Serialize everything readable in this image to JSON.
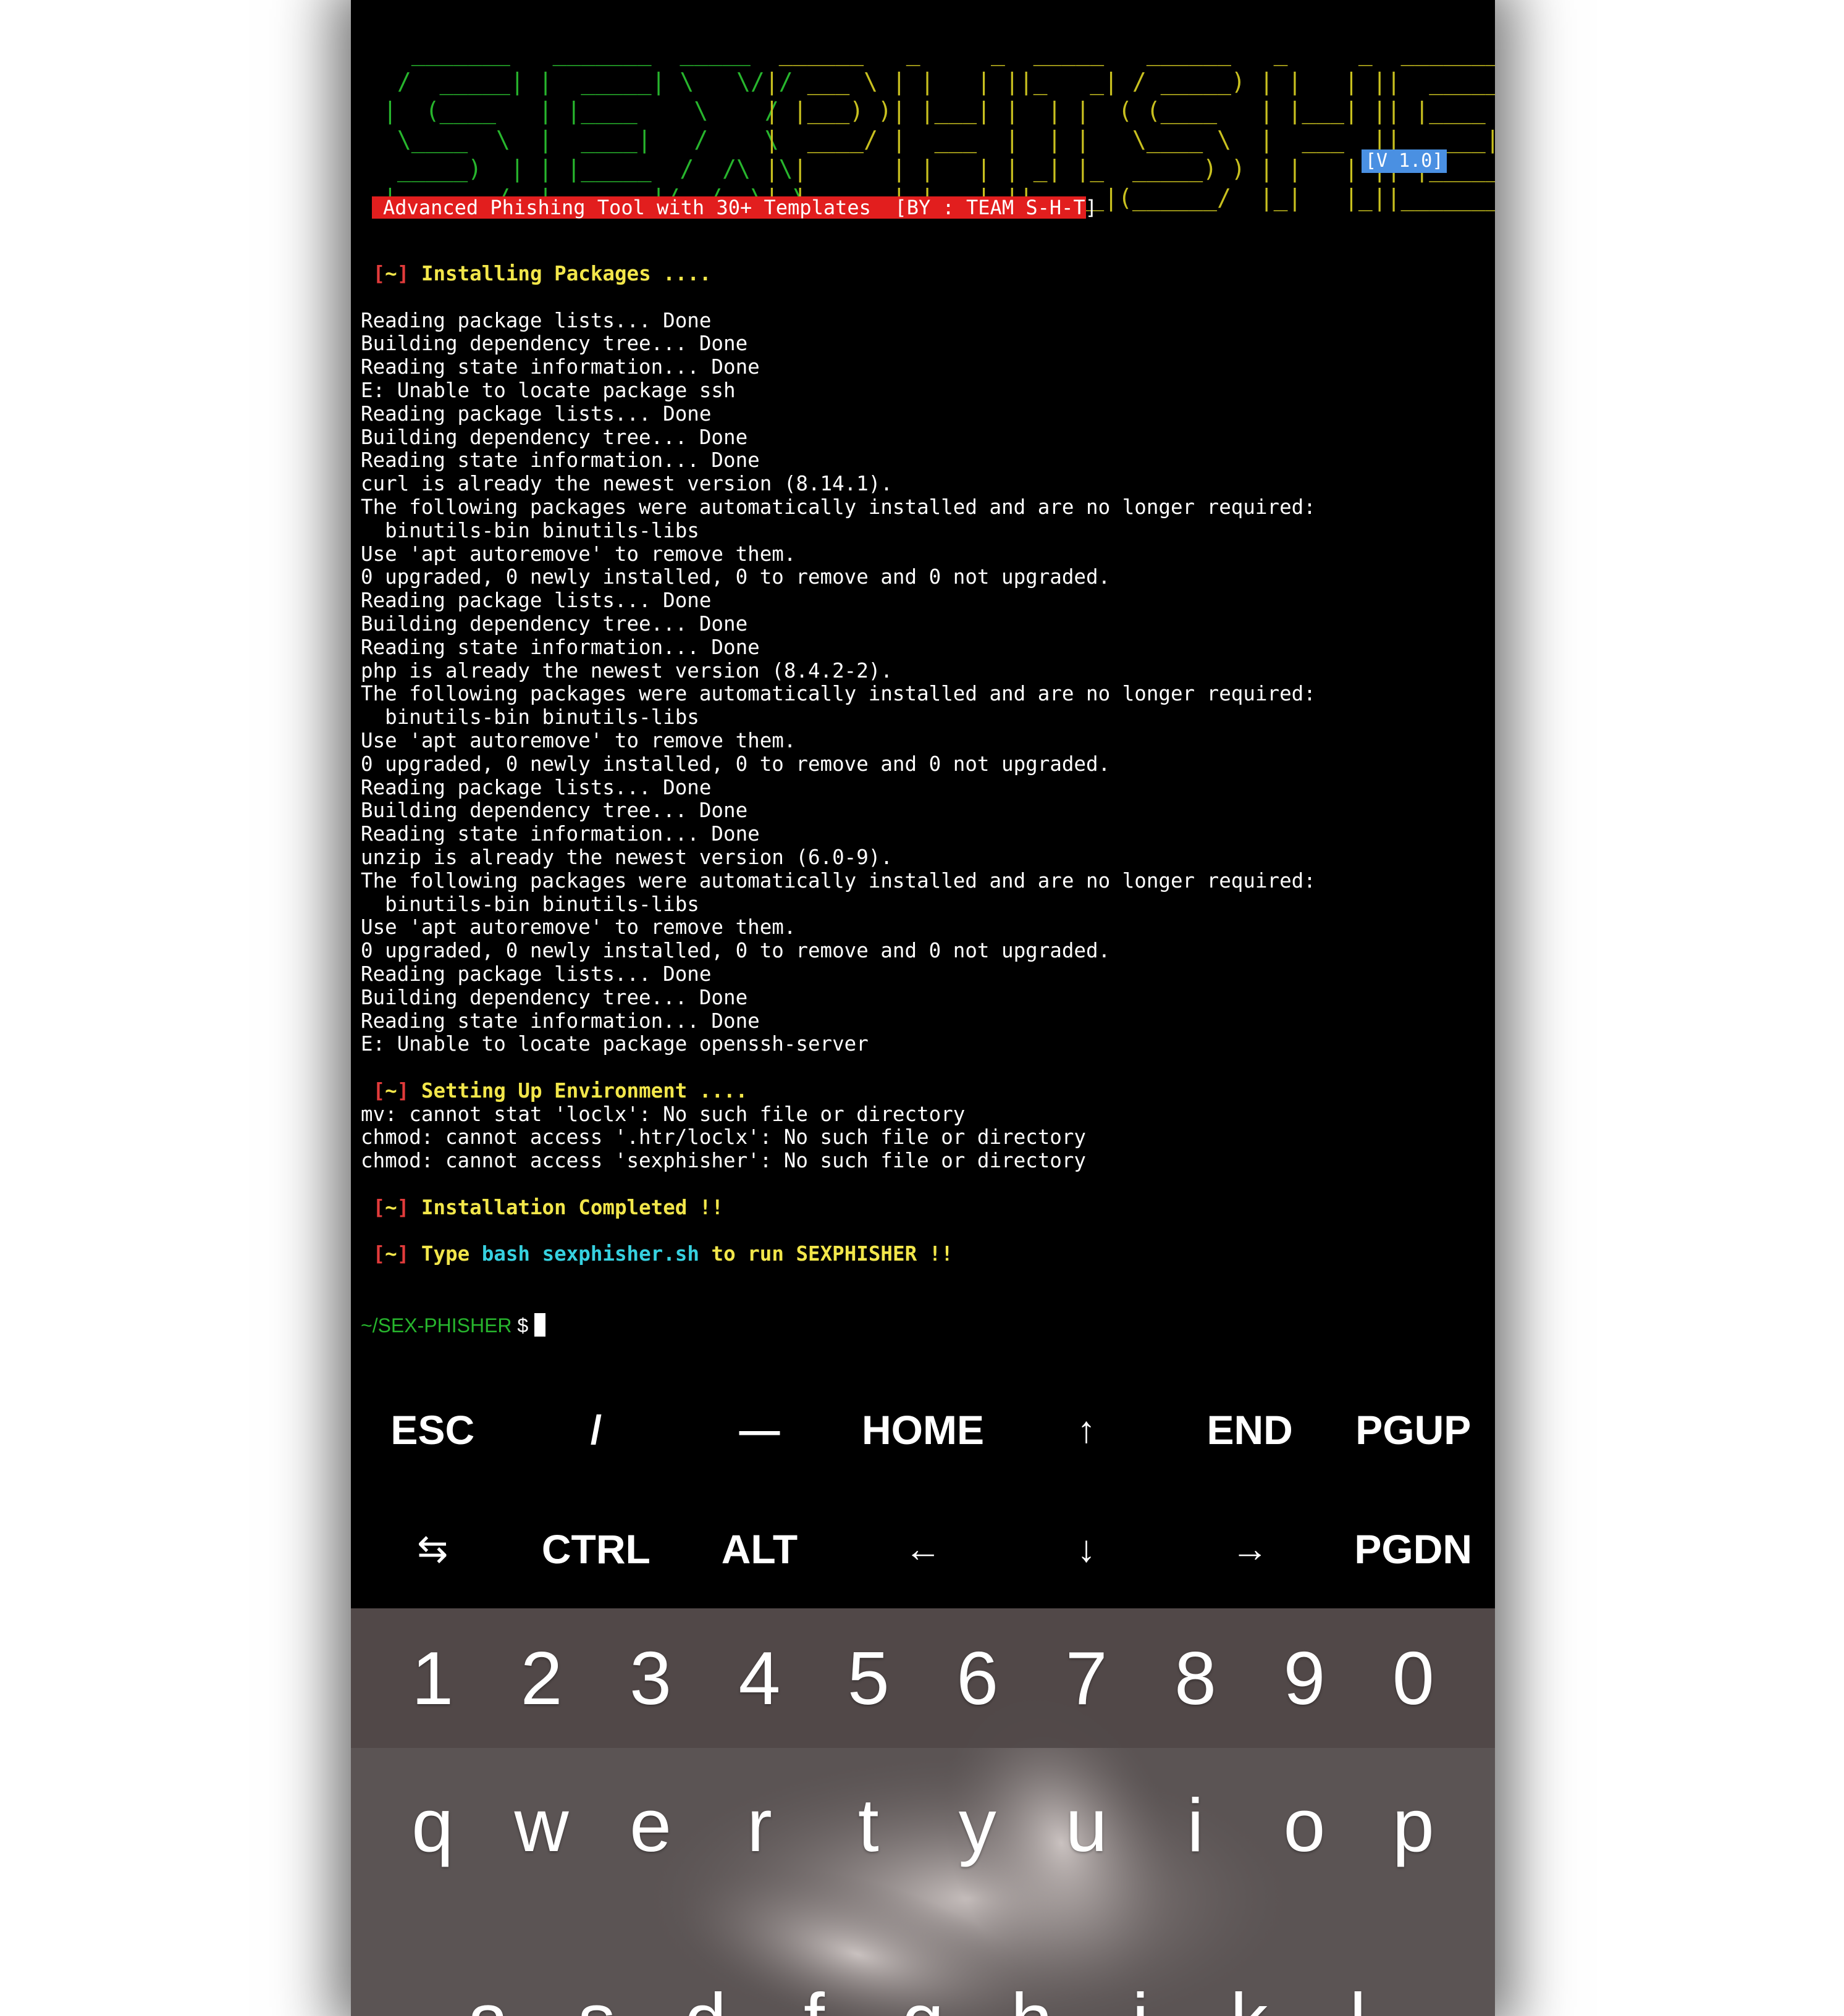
{
  "banner": {
    "sex_art": "  _______   _______  _____  _\n /  _____| |  _____| \\   \\/ /\n|  (____   | |____    \\    /\n \\____  \\  |  ____|   /    \\\n _____)  | | |_____  /  /\\  \\\n|_______/  |_______|/__/  \\__\\",
    "phisher_art": " ______   _     _  _____   ______   _     _  _______  ______\n|  ___ \\ | |   | ||_   _| / _____) | |   | ||  _____||  ___ \\\n| |___) )| |___| |  | |  ( (____   | |___| || |____  | |___) )\n|  ____/ |  ___  |  | |   \\____ \\  |  ___  ||  ____| |  __  /\n| |      | |   | | _| |_  _____) ) | |   | || |_____ | |  \\ \\\n|_|      |_|   |_||_____|(______/  |_|   |_||_______||_|   \\_\\",
    "version": "[V 1.0]",
    "tagline": "Advanced Phishing Tool with 30+ Templates  [BY : TEAM S-H-T]"
  },
  "status": {
    "installing": "Installing Packages ....",
    "environment": "Setting Up Environment ....",
    "completed": "Installation Completed !!",
    "marker_open": "[",
    "marker_tilde": "~",
    "marker_close": "]",
    "type_prefix": "Type ",
    "type_command": "bash sexphisher.sh",
    "type_suffix": " to run SEXPHISHER !!"
  },
  "log_install": [
    "Reading package lists... Done",
    "Building dependency tree... Done",
    "Reading state information... Done",
    "E: Unable to locate package ssh",
    "Reading package lists... Done",
    "Building dependency tree... Done",
    "Reading state information... Done",
    "curl is already the newest version (8.14.1).",
    "The following packages were automatically installed and are no longer required:",
    "  binutils-bin binutils-libs",
    "Use 'apt autoremove' to remove them.",
    "0 upgraded, 0 newly installed, 0 to remove and 0 not upgraded.",
    "Reading package lists... Done",
    "Building dependency tree... Done",
    "Reading state information... Done",
    "php is already the newest version (8.4.2-2).",
    "The following packages were automatically installed and are no longer required:",
    "  binutils-bin binutils-libs",
    "Use 'apt autoremove' to remove them.",
    "0 upgraded, 0 newly installed, 0 to remove and 0 not upgraded.",
    "Reading package lists... Done",
    "Building dependency tree... Done",
    "Reading state information... Done",
    "unzip is already the newest version (6.0-9).",
    "The following packages were automatically installed and are no longer required:",
    "  binutils-bin binutils-libs",
    "Use 'apt autoremove' to remove them.",
    "0 upgraded, 0 newly installed, 0 to remove and 0 not upgraded.",
    "Reading package lists... Done",
    "Building dependency tree... Done",
    "Reading state information... Done",
    "E: Unable to locate package openssh-server"
  ],
  "log_env": [
    "mv: cannot stat 'loclx': No such file or directory",
    "chmod: cannot access '.htr/loclx': No such file or directory",
    "chmod: cannot access 'sexphisher': No such file or directory"
  ],
  "prompt": {
    "path": "~/SEX-PHISHER",
    "symbol": " $"
  },
  "extra_keys": {
    "row1": [
      "ESC",
      "/",
      "—",
      "HOME",
      "↑",
      "END",
      "PGUP"
    ],
    "row2": [
      "⇆",
      "CTRL",
      "ALT",
      "←",
      "↓",
      "→",
      "PGDN"
    ]
  },
  "keyboard": {
    "numbers": [
      "1",
      "2",
      "3",
      "4",
      "5",
      "6",
      "7",
      "8",
      "9",
      "0"
    ],
    "row_q": [
      "q",
      "w",
      "e",
      "r",
      "t",
      "y",
      "u",
      "i",
      "o",
      "p"
    ],
    "row_a": [
      "a",
      "s",
      "d",
      "f",
      "g",
      "h",
      "j",
      "k",
      "l"
    ]
  },
  "colors": {
    "terminal_bg": "#000000",
    "banner_green": "#27b52d",
    "banner_yellow": "#c8c01f",
    "status_yellow": "#f2e64a",
    "bracket_red": "#e23b3b",
    "command_cyan": "#36d1e0",
    "tagline_bg": "#e21e1e",
    "version_bg": "#4a90e2"
  }
}
